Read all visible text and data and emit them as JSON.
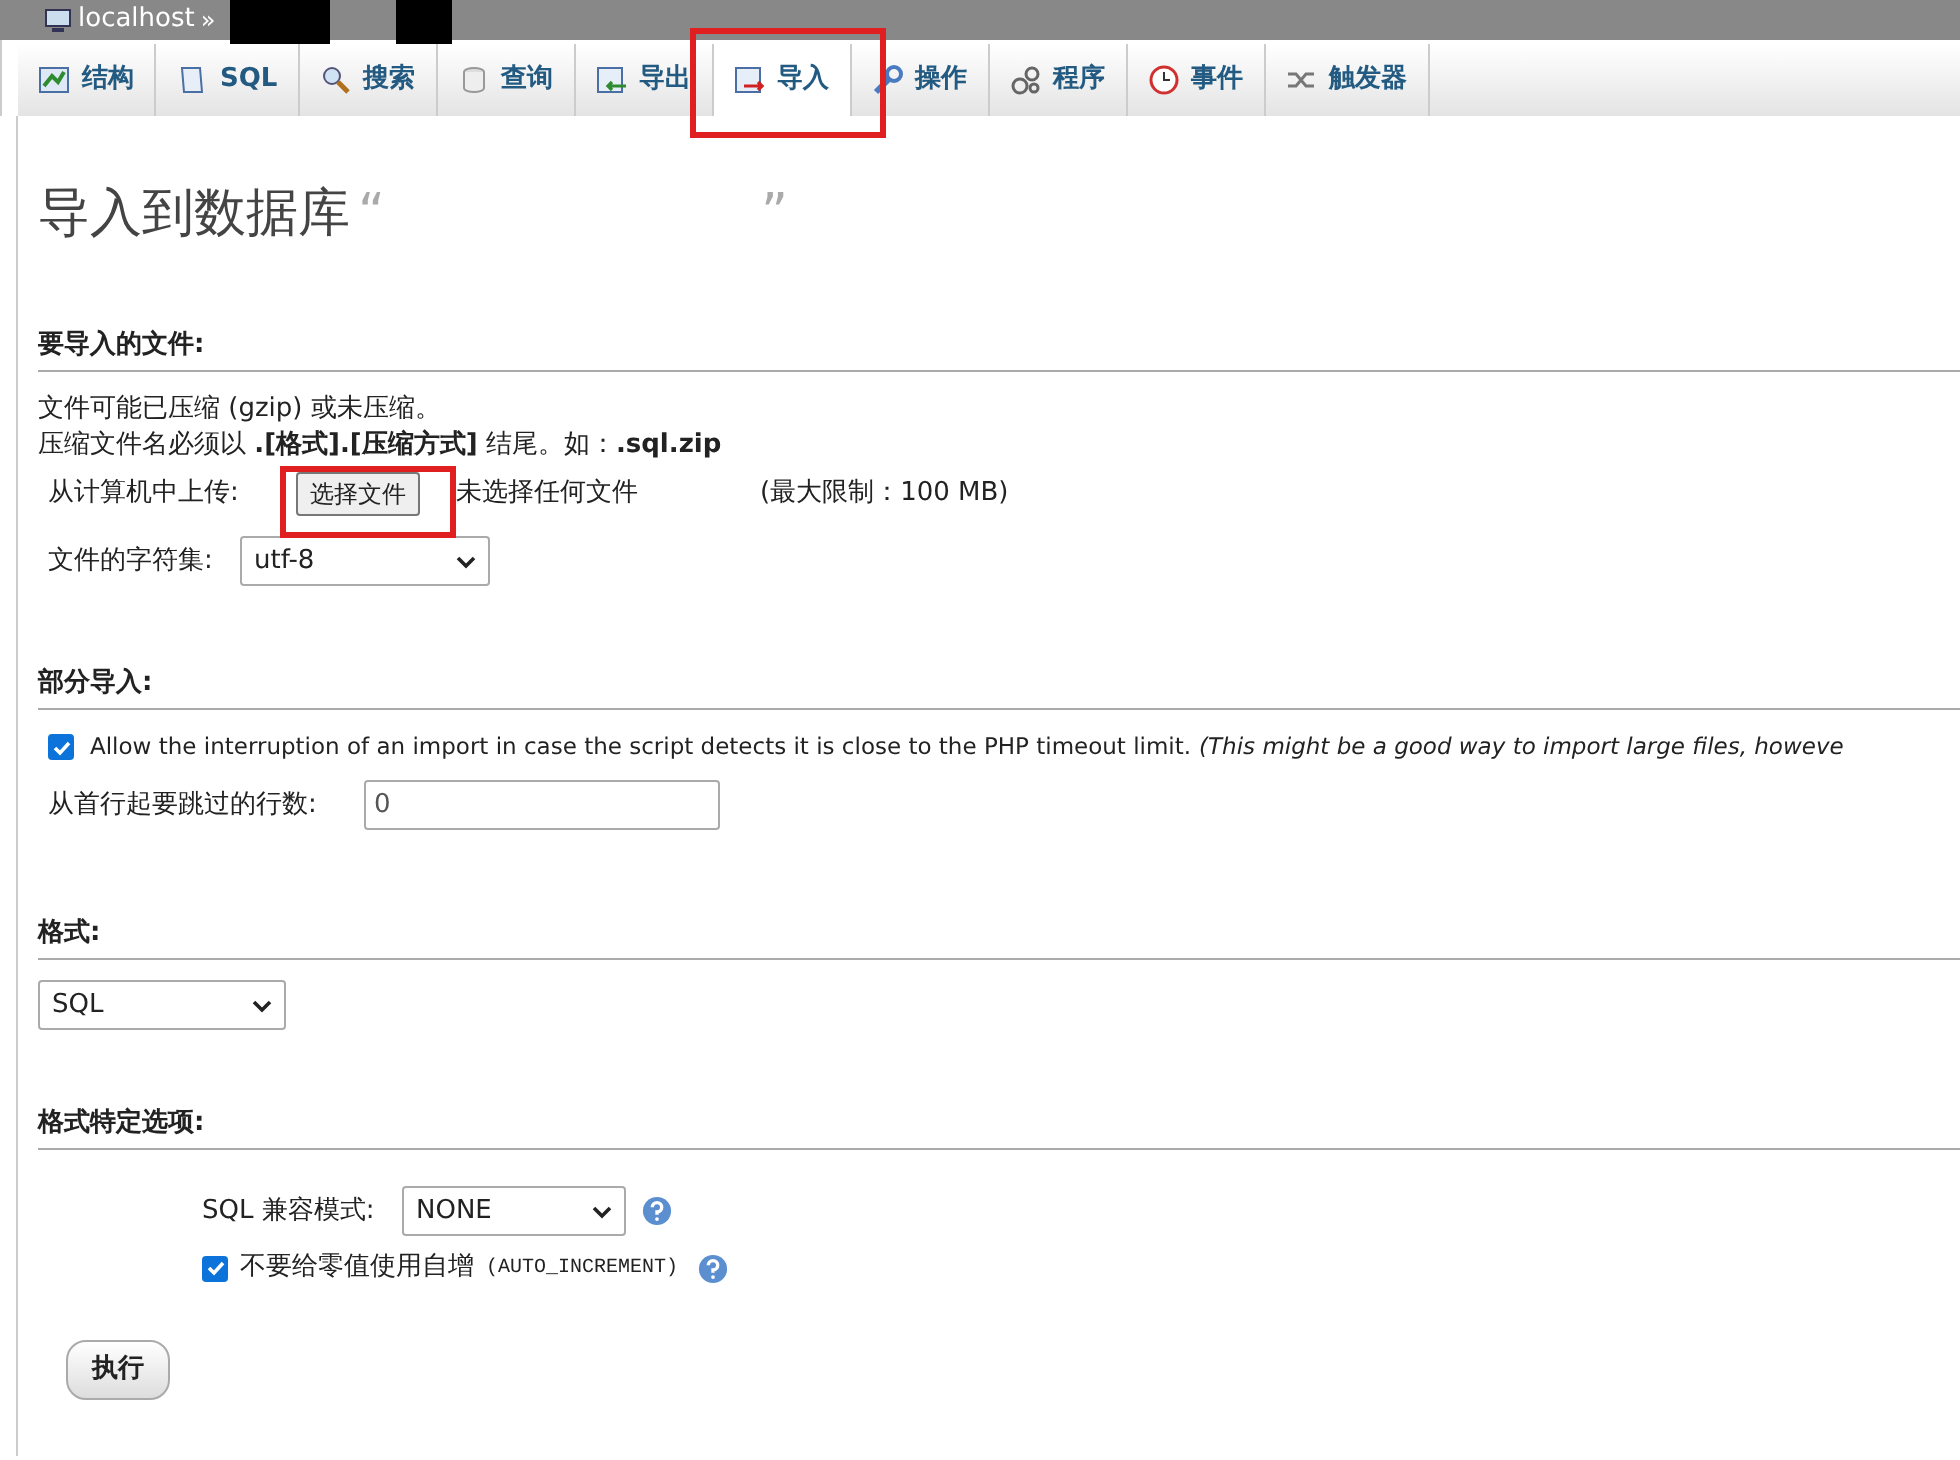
{
  "breadcrumb": {
    "server": "localhost",
    "separator": "»"
  },
  "tabs": [
    {
      "label": "结构",
      "kind": "structure",
      "selected": false
    },
    {
      "label": "SQL",
      "kind": "sql",
      "selected": false
    },
    {
      "label": "搜索",
      "kind": "search",
      "selected": false
    },
    {
      "label": "查询",
      "kind": "query",
      "selected": false
    },
    {
      "label": "导出",
      "kind": "export",
      "selected": false
    },
    {
      "label": "导入",
      "kind": "import",
      "selected": true
    },
    {
      "label": "操作",
      "kind": "operations",
      "selected": false
    },
    {
      "label": "程序",
      "kind": "routines",
      "selected": false
    },
    {
      "label": "事件",
      "kind": "events",
      "selected": false
    },
    {
      "label": "触发器",
      "kind": "triggers",
      "selected": false
    }
  ],
  "page_title": {
    "text": "导入到数据库",
    "quote_open": "“",
    "quote_close": "”"
  },
  "file_section": {
    "heading": "要导入的文件:",
    "note_1": "文件可能已压缩 (gzip) 或未压缩。",
    "note_2": "压缩文件名必须以 **.[格式].[压缩方式]** 结尾。如：**.sql.zip**",
    "upload_label": "从计算机中上传:",
    "choose_button": "选择文件",
    "no_file": "未选择任何文件",
    "max_size": "(最大限制：100 MB)",
    "charset_label": "文件的字符集:",
    "charset_value": "utf-8"
  },
  "partial_section": {
    "heading": "部分导入:",
    "allow_interrupt": {
      "checked": true,
      "label": "Allow the interruption of an import in case the script detects it is close to the PHP timeout limit.",
      "hint": "(This might be a good way to import large files, howeve"
    },
    "skip_label": "从首行起要跳过的行数:",
    "skip_value": "0"
  },
  "format_section": {
    "heading": "格式:",
    "value": "SQL"
  },
  "format_options": {
    "heading": "格式特定选项:",
    "compat_label": "SQL 兼容模式:",
    "compat_value": "NONE",
    "no_auto_value": {
      "checked": true,
      "label": "不要给零值使用自增",
      "code": "(AUTO_INCREMENT)"
    }
  },
  "go_button": "执行"
}
